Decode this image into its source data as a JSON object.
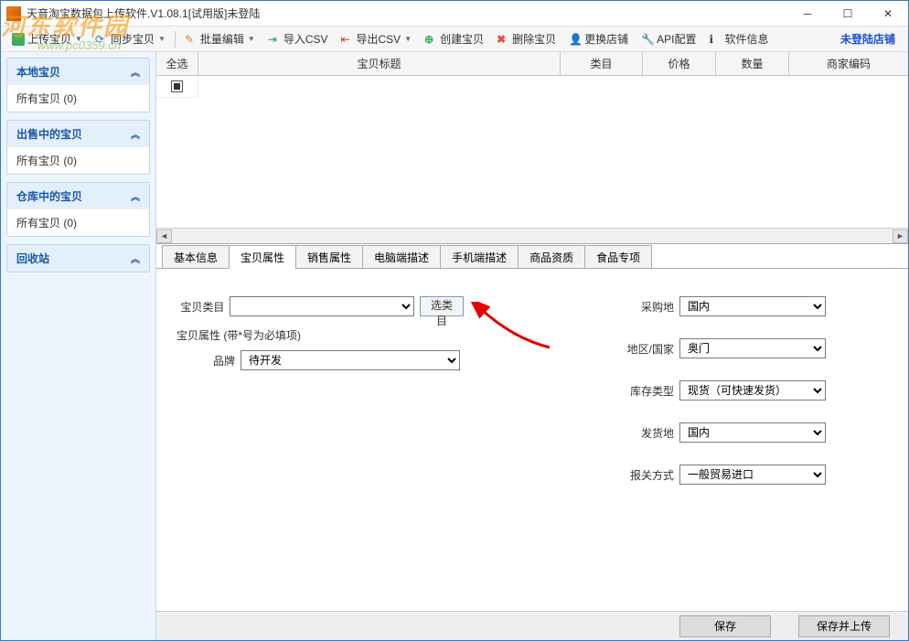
{
  "window": {
    "title": "天音淘宝数据包上传软件.V1.08.1[试用版]未登陆"
  },
  "toolbar": {
    "upload": "上传宝贝",
    "sync": "同步宝贝",
    "batch": "批量编辑",
    "importcsv": "导入CSV",
    "exportcsv": "导出CSV",
    "create": "创建宝贝",
    "delete": "删除宝贝",
    "changeshop": "更换店铺",
    "apiconfig": "API配置",
    "swinfo": "软件信息",
    "loginshop": "未登陆店铺"
  },
  "sidebar": {
    "g1": {
      "title": "本地宝贝",
      "item": "所有宝贝 (0)"
    },
    "g2": {
      "title": "出售中的宝贝",
      "item": "所有宝贝 (0)"
    },
    "g3": {
      "title": "仓库中的宝贝",
      "item": "所有宝贝 (0)"
    },
    "g4": {
      "title": "回收站"
    }
  },
  "grid": {
    "h_sel": "全选",
    "h_title": "宝贝标题",
    "h_cat": "类目",
    "h_price": "价格",
    "h_qty": "数量",
    "h_code": "商家编码"
  },
  "tabs": {
    "t1": "基本信息",
    "t2": "宝贝属性",
    "t3": "销售属性",
    "t4": "电脑端描述",
    "t5": "手机端描述",
    "t6": "商品资质",
    "t7": "食品专项"
  },
  "form": {
    "cat_label": "宝贝类目",
    "cat_value": "",
    "selcat_btn": "选类目",
    "prop_note": "宝贝属性 (带*号为必填项)",
    "brand_label": "品牌",
    "brand_value": "待开发",
    "r1_label": "采购地",
    "r1_value": "国内",
    "r2_label": "地区/国家",
    "r2_value": "奥门",
    "r3_label": "库存类型",
    "r3_value": "现货（可快速发货）",
    "r4_label": "发货地",
    "r4_value": "国内",
    "r5_label": "报关方式",
    "r5_value": "一般贸易进口"
  },
  "footer": {
    "save": "保存",
    "saveupload": "保存并上传"
  },
  "watermark": {
    "line1": "河东软件园",
    "line2": "www.pc0359.cn"
  }
}
